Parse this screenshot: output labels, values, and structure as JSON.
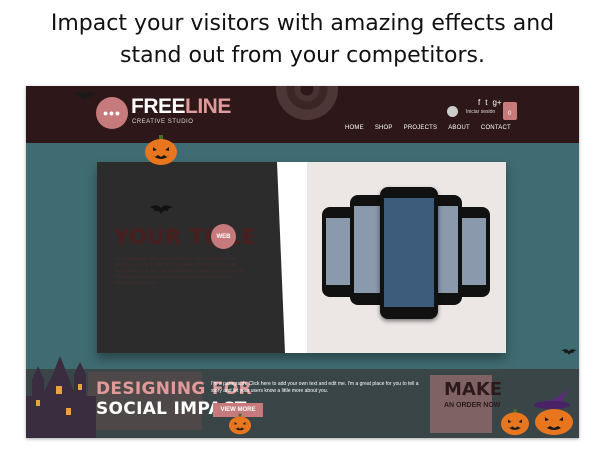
{
  "headline": {
    "line1": "Impact your visitors with amazing effects and",
    "line2": "stand out from your competitors."
  },
  "site": {
    "logo_glyph": "•••",
    "brand_part1": "FREE",
    "brand_part2": "LINE",
    "brand_sub": "CREATIVE STUDIO",
    "login_label": "Iniciar sesión",
    "cart_count": "0",
    "social_icons": [
      "facebook-icon",
      "twitter-icon",
      "google-plus-icon"
    ],
    "social_glyphs": [
      "f",
      "t",
      "g+"
    ],
    "menu": [
      "HOME",
      "SHOP",
      "PROJECTS",
      "ABOUT",
      "CONTACT"
    ]
  },
  "hero": {
    "title": "YOUR TITLE",
    "badge": "WEB",
    "paragraph": "I'm a paragraph. Click here to add your own text and edit me. It's easy. Just click \"Edit Text\" or double click me and you can start adding your own content and make changes to the font. I'm a great place for you to tell a story and let your users know a little more about you."
  },
  "banner": {
    "title1": "DESIGNING FOR",
    "title2": "SOCIAL IMPACT",
    "paragraph": "I'm a paragraph. Click here to add your own text and edit me. I'm a great place for you to tell a story and let your users know a little more about you.",
    "button": "VIEW MORE",
    "make": "MAKE",
    "make_sub": "AN ORDER NOW"
  },
  "colors": {
    "nav_bg": "#2d1718",
    "accent": "#c67a7b",
    "frame_bg": "#3f6c72"
  }
}
